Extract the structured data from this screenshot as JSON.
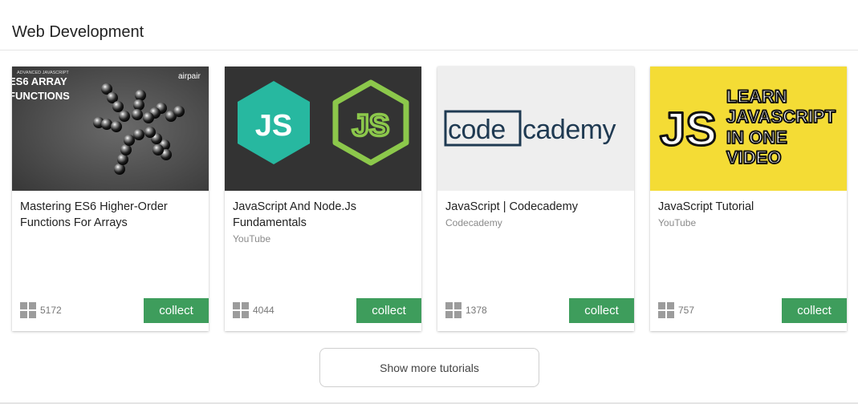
{
  "section": {
    "title": "Web Development"
  },
  "cards": [
    {
      "title": "Mastering ES6 Higher-Order Functions For Arrays",
      "source": "",
      "count": "5172",
      "collect_label": "collect",
      "thumbnail": {
        "kicker": "ADVANCED JAVASCRIPT",
        "heading_line1": "ES6 ARRAY",
        "heading_line2": "FUNCTIONS",
        "brand": "airpair",
        "background": "#4b4b4b"
      }
    },
    {
      "title": "JavaScript And Node.Js Fundamentals",
      "source": "YouTube",
      "count": "4044",
      "collect_label": "collect",
      "thumbnail": {
        "logo_left": "JS",
        "logo_right": "JS",
        "background": "#333333",
        "left_color": "#27b8a0",
        "right_color": "#8cc84b"
      }
    },
    {
      "title": "JavaScript | Codecademy",
      "source": "Codecademy",
      "count": "1378",
      "collect_label": "collect",
      "thumbnail": {
        "logo_part1": "code",
        "logo_part2": "cademy",
        "background": "#eeeeee",
        "logo_color": "#1f3a52"
      }
    },
    {
      "title": "JavaScript Tutorial",
      "source": "YouTube",
      "count": "757",
      "collect_label": "collect",
      "thumbnail": {
        "logo": "JS",
        "line1": "LEARN",
        "line2": "JAVASCRIPT",
        "line3": "IN ONE",
        "line4": "VIDEO",
        "background": "#f4dc35"
      }
    }
  ],
  "show_more_label": "Show more tutorials",
  "colors": {
    "collect_button": "#3e9d5c",
    "grid_icon": "#9c9c9c"
  },
  "icons": {
    "count_icon": "grid-icon"
  }
}
